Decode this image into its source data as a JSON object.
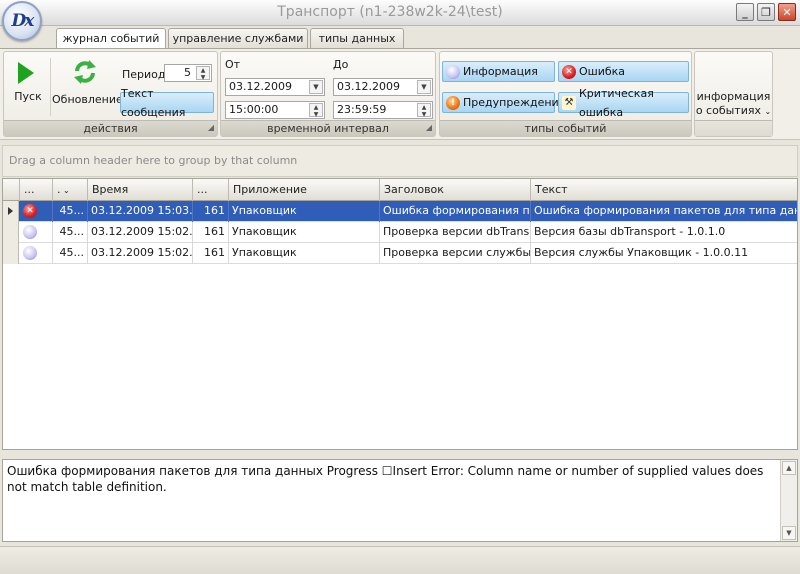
{
  "window": {
    "title": "Транспорт (n1-238w2k-24\\test)",
    "logo_text": "Dx"
  },
  "tabs": [
    {
      "label": "журнал событий",
      "active": true
    },
    {
      "label": "управление службами",
      "active": false
    },
    {
      "label": "типы данных",
      "active": false
    }
  ],
  "ribbon": {
    "actions": {
      "caption": "действия",
      "start_label": "Пуск",
      "refresh_label": "Обновление",
      "period_label": "Период",
      "period_value": "5",
      "message_text_label": "Текст сообщения"
    },
    "interval": {
      "caption": "временной интервал",
      "from_label": "От",
      "to_label": "До",
      "from_date": "03.12.2009",
      "from_time": "15:00:00",
      "to_date": "03.12.2009",
      "to_time": "23:59:59"
    },
    "event_types": {
      "caption": "типы событий",
      "info_label": "Информация",
      "error_label": "Ошибка",
      "warning_label": "Предупреждение",
      "critical_label": "Критическая ошибка"
    },
    "event_info": {
      "line1": "информация",
      "line2": "о событиях"
    }
  },
  "group_panel": {
    "text": "Drag a column header here to group by that column"
  },
  "grid": {
    "columns": [
      "...",
      ".",
      "Время",
      "...",
      "Приложение",
      "Заголовок",
      "Текст"
    ],
    "rows": [
      {
        "icon": "error-icon",
        "id": "45...",
        "time": "03.12.2009 15:03...",
        "code": "161",
        "app": "Упаковщик",
        "header": "Ошибка формирования пак...",
        "text": "Ошибка формирования пакетов для типа данных Pr",
        "selected": true
      },
      {
        "icon": "info-icon",
        "id": "45...",
        "time": "03.12.2009 15:02...",
        "code": "161",
        "app": "Упаковщик",
        "header": "Проверка версии dbTrans...",
        "text": "Версия базы dbTransport - 1.0.1.0",
        "selected": false
      },
      {
        "icon": "info-icon",
        "id": "45...",
        "time": "03.12.2009 15:02...",
        "code": "161",
        "app": "Упаковщик",
        "header": "Проверка версии службы",
        "text": "Версия службы Упаковщик - 1.0.0.11",
        "selected": false
      }
    ]
  },
  "detail": {
    "text": "Ошибка формирования пакетов для типа данных Progress ☐Insert Error: Column name or number of supplied values does not match table definition."
  }
}
